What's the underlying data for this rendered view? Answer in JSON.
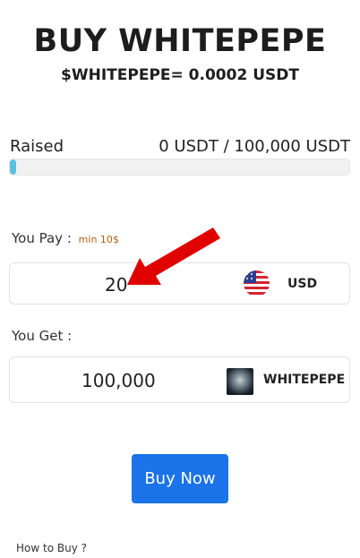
{
  "header": {
    "title": "BUY WHITEPEPE",
    "price": "$WHITEPEPE= 0.0002 USDT"
  },
  "raised": {
    "label": "Raised",
    "value": "0 USDT / 100,000 USDT",
    "progress_fraction": 0.0
  },
  "pay": {
    "label": "You Pay :",
    "min_note": "min 10$",
    "amount": "20",
    "currency": "USD",
    "icon": "us-flag-icon"
  },
  "get": {
    "label": "You Get :",
    "amount": "100,000",
    "currency": "WHITEPEPE",
    "icon": "whitepepe-token-icon"
  },
  "actions": {
    "buy_label": "Buy Now",
    "howto_link": "How to Buy ?"
  },
  "colors": {
    "accent": "#1a73e8",
    "progress": "#5bc0de",
    "annotation_arrow": "#e00000"
  }
}
